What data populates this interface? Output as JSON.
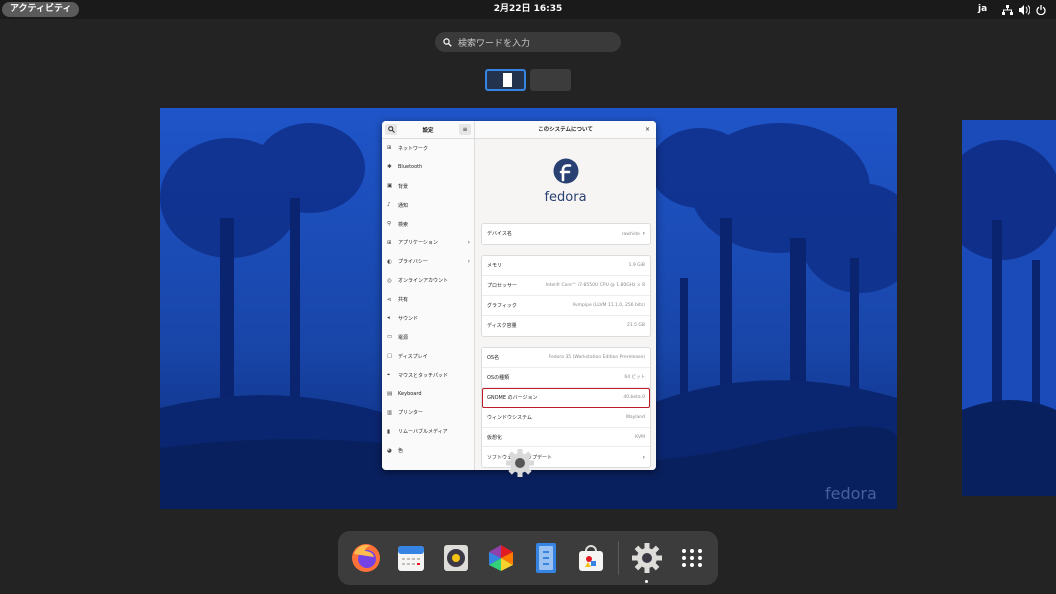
{
  "topbar": {
    "activities_label": "アクティビティ",
    "clock": "2月22日 16:35",
    "lang": "ja",
    "tray_icons": [
      "network-icon",
      "volume-icon",
      "power-icon"
    ]
  },
  "search": {
    "placeholder": "検索ワードを入力"
  },
  "settings": {
    "sidebar_title": "設定",
    "items": [
      {
        "label": "ネットワーク",
        "icon": "network-icon",
        "chevron": false
      },
      {
        "label": "Bluetooth",
        "icon": "bluetooth-icon",
        "chevron": false
      },
      {
        "label": "背景",
        "icon": "background-icon",
        "chevron": false
      },
      {
        "label": "通知",
        "icon": "bell-icon",
        "chevron": false
      },
      {
        "label": "検索",
        "icon": "search-icon",
        "chevron": false
      },
      {
        "label": "アプリケーション",
        "icon": "apps-icon",
        "chevron": true
      },
      {
        "label": "プライバシー",
        "icon": "privacy-icon",
        "chevron": true
      },
      {
        "label": "オンラインアカウント",
        "icon": "online-accounts-icon",
        "chevron": false
      },
      {
        "label": "共有",
        "icon": "share-icon",
        "chevron": false
      },
      {
        "label": "サウンド",
        "icon": "sound-icon",
        "chevron": false
      },
      {
        "label": "電源",
        "icon": "power-icon",
        "chevron": false
      },
      {
        "label": "ディスプレイ",
        "icon": "display-icon",
        "chevron": false
      },
      {
        "label": "マウスとタッチパッド",
        "icon": "mouse-icon",
        "chevron": false
      },
      {
        "label": "Keyboard",
        "icon": "keyboard-icon",
        "chevron": false
      },
      {
        "label": "プリンター",
        "icon": "printer-icon",
        "chevron": false
      },
      {
        "label": "リムーバブルメディア",
        "icon": "usb-icon",
        "chevron": false
      },
      {
        "label": "色",
        "icon": "color-icon",
        "chevron": false
      }
    ],
    "main_title": "このシステムについて",
    "logo_text": "fedora",
    "device": {
      "label": "デバイス名",
      "value": "rawhide"
    },
    "hardware": [
      {
        "label": "メモリ",
        "value": "1.9 GiB"
      },
      {
        "label": "プロセッサー",
        "value": "Intel® Core™ i7-8550U CPU @ 1.80GHz × 8"
      },
      {
        "label": "グラフィック",
        "value": "llvmpipe (LLVM 11.1.0, 256 bits)"
      },
      {
        "label": "ディスク容量",
        "value": "21.5 GB"
      }
    ],
    "os": [
      {
        "label": "OS名",
        "value": "Fedora 35 (Workstation Edition Prerelease)",
        "highlight": false
      },
      {
        "label": "OSの種類",
        "value": "64 ビット",
        "highlight": false
      },
      {
        "label": "GNOME のバージョン",
        "value": "40.beta.0",
        "highlight": true
      },
      {
        "label": "ウィンドウシステム",
        "value": "Wayland",
        "highlight": false
      },
      {
        "label": "仮想化",
        "value": "KVM",
        "highlight": false
      },
      {
        "label": "ソフトウェアのアップデート",
        "value": "",
        "highlight": false
      }
    ]
  },
  "watermark": "fedora",
  "dock": {
    "apps": [
      "firefox-icon",
      "calendar-icon",
      "rhythmbox-icon",
      "photos-icon",
      "files-icon",
      "software-icon",
      "settings-icon",
      "app-grid-icon"
    ]
  }
}
